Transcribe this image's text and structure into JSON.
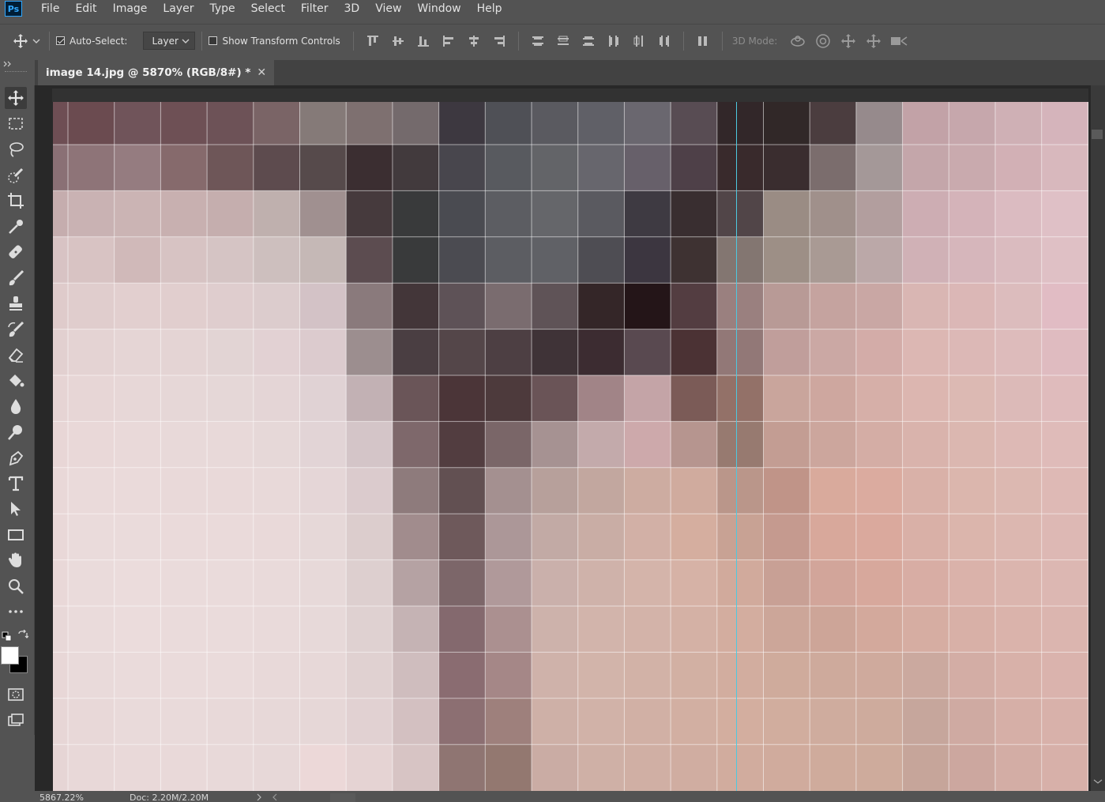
{
  "app": {
    "logo_text": "Ps",
    "brand_color": "#31a8ff"
  },
  "menu": [
    "File",
    "Edit",
    "Image",
    "Layer",
    "Type",
    "Select",
    "Filter",
    "3D",
    "View",
    "Window",
    "Help"
  ],
  "options": {
    "auto_select_label": "Auto-Select:",
    "auto_select_checked": true,
    "layer_dropdown_value": "Layer",
    "show_transform_label": "Show Transform Controls",
    "show_transform_checked": false,
    "mode_3d_label": "3D Mode:"
  },
  "document": {
    "tab_title": "image 14.jpg @ 5870% (RGB/8#) *",
    "close_glyph": "✕"
  },
  "status": {
    "zoom": "5867.22%",
    "doc_size": "Doc: 2.20M/2.20M"
  },
  "tools": [
    "move-tool",
    "rectangular-marquee-tool",
    "lasso-tool",
    "quick-selection-tool",
    "crop-tool",
    "eyedropper-tool",
    "healing-brush-tool",
    "brush-tool",
    "clone-stamp-tool",
    "history-brush-tool",
    "eraser-tool",
    "paint-bucket-tool",
    "blur-tool",
    "dodge-tool",
    "pen-tool",
    "type-tool",
    "path-selection-tool",
    "rectangle-tool",
    "hand-tool",
    "zoom-tool",
    "more-tools"
  ],
  "colors": {
    "foreground": "#ffffff",
    "background": "#000000",
    "guide": "#4dc9e0"
  },
  "pixels": [
    [
      "#6e4e54",
      "#6b4b50",
      "#70545a",
      "#6e5055",
      "#6d5257",
      "#7a6466",
      "#857a78",
      "#7e7070",
      "#746a6c",
      "#3d3840",
      "#4f5056",
      "#5a5a60",
      "#606067",
      "#6a676f",
      "#584c53",
      "#322729",
      "#312828",
      "#4b3d3f",
      "#968a8c",
      "#c2a2a7",
      "#c6a7ac",
      "#cfb0b5",
      "#d5b4bb",
      "#e3c8cc"
    ],
    [
      "#8a7075",
      "#8e7478",
      "#957c80",
      "#866a6c",
      "#6e5658",
      "#5d4b4e",
      "#564a4b",
      "#3b2e31",
      "#423a3d",
      "#48464d",
      "#585a5f",
      "#636468",
      "#67666d",
      "#67606a",
      "#4e4048",
      "#392a2c",
      "#3a2d2f",
      "#7b6d6d",
      "#a49898",
      "#c4a6aa",
      "#c9aaae",
      "#d2b0b5",
      "#d8b8bd",
      "#e3c6ca"
    ],
    [
      "#c5adae",
      "#c9b2b3",
      "#cbb4b4",
      "#c8b0b0",
      "#c5aeae",
      "#bfb0ae",
      "#a09090",
      "#463a3d",
      "#393a3b",
      "#4a4b51",
      "#5c5d62",
      "#65666a",
      "#5a5a60",
      "#3e3a42",
      "#392e30",
      "#514548",
      "#9a8c84",
      "#a0908b",
      "#b29e9e",
      "#cdadb3",
      "#d4b3b9",
      "#dbbbc1",
      "#dfc0c6",
      "#e5c8cd"
    ],
    [
      "#d8c3c4",
      "#d8c3c3",
      "#d0b9b9",
      "#d7c3c3",
      "#d5c4c4",
      "#cdbfbe",
      "#c5b8b6",
      "#5c4c50",
      "#393a3b",
      "#4b4b51",
      "#5c5d62",
      "#606166",
      "#4e4d53",
      "#3c3640",
      "#3e3232",
      "#837671",
      "#9d8f86",
      "#a99a94",
      "#bba8a8",
      "#d0b1b6",
      "#d6b6bb",
      "#dabbbf",
      "#dfc0c5",
      "#e3c5ca"
    ],
    [
      "#dfcbcb",
      "#e0cdcd",
      "#e2cfcf",
      "#e1cece",
      "#dfcdce",
      "#dccccd",
      "#d3c2c6",
      "#8a7a7c",
      "#433639",
      "#5e5257",
      "#7a6c6f",
      "#5f5357",
      "#342628",
      "#241518",
      "#533d41",
      "#9a807f",
      "#b89a96",
      "#c5a39f",
      "#c9a7a4",
      "#d9b6b3",
      "#dbb7b6",
      "#dcbcbd",
      "#e1bcc4",
      "#e3c5c8"
    ],
    [
      "#e2d0d0",
      "#e4d3d3",
      "#e5d5d5",
      "#e4d4d4",
      "#e2d4d4",
      "#e2d1d3",
      "#dccbce",
      "#9c8e8f",
      "#4a3e42",
      "#544649",
      "#4d3f43",
      "#3f3337",
      "#3c2c31",
      "#594950",
      "#4b3234",
      "#927877",
      "#c09e9b",
      "#cba8a4",
      "#d3aca8",
      "#dcb7b3",
      "#dcb8b6",
      "#ddbbbb",
      "#dfbbc0",
      "#e3c3c7"
    ],
    [
      "#e6d4d4",
      "#e7d6d6",
      "#e7d7d7",
      "#e6d7d7",
      "#e5d7d7",
      "#e4d5d6",
      "#e0d2d4",
      "#c2b1b4",
      "#6a5558",
      "#4b3538",
      "#4d3a3c",
      "#6a5457",
      "#a18487",
      "#c4a4a7",
      "#7b5b57",
      "#937168",
      "#c9a59c",
      "#cea79f",
      "#d6afa8",
      "#dcb6b0",
      "#dcb9b3",
      "#dcbab8",
      "#dfbbbc",
      "#e3c2c4"
    ],
    [
      "#e8d6d6",
      "#e9d8d8",
      "#e9d9d9",
      "#e8d9d9",
      "#e8d9d9",
      "#e6d8d8",
      "#e2d4d6",
      "#d4c5c8",
      "#7e686b",
      "#523d40",
      "#7a6668",
      "#a69292",
      "#c3aaab",
      "#cda9ab",
      "#b6958f",
      "#977a70",
      "#c39d93",
      "#cca69d",
      "#d4ada5",
      "#d9b3ac",
      "#dbb7b0",
      "#ddb9b5",
      "#dfbbb9",
      "#e1bfbf"
    ],
    [
      "#e9d8d8",
      "#eadada",
      "#eadada",
      "#e9d9d9",
      "#e9d9d9",
      "#e8d9d9",
      "#e5d6d7",
      "#dbcbcd",
      "#8e7b7c",
      "#625052",
      "#a49090",
      "#b7a09b",
      "#c2a79f",
      "#cdaca1",
      "#d0ab9e",
      "#ba968a",
      "#c09488",
      "#d9aa9c",
      "#dbab9f",
      "#d9b1a8",
      "#dbb6ad",
      "#dcb8b1",
      "#deb9b5",
      "#e0bcbb"
    ],
    [
      "#e9d8d8",
      "#eadbdb",
      "#eadbdb",
      "#eadada",
      "#eadada",
      "#e9d9d9",
      "#e6d8d8",
      "#dccdcd",
      "#a18c8d",
      "#6e595b",
      "#ac9798",
      "#c2aaa5",
      "#c9ada5",
      "#d2b0a6",
      "#d5ae9f",
      "#c8a294",
      "#c59a8f",
      "#d8a89b",
      "#daa99d",
      "#d9b0a7",
      "#dbb5ac",
      "#dcb7b0",
      "#ddb8b4",
      "#dfbbba"
    ],
    [
      "#e9d8d8",
      "#eadbdb",
      "#ebdcdc",
      "#eadbdb",
      "#eadbdb",
      "#e9dada",
      "#e7d9d9",
      "#ddcfcf",
      "#b5a2a3",
      "#7c6669",
      "#b0999a",
      "#cab0ab",
      "#cfb2aa",
      "#d4b4aa",
      "#d6b2a6",
      "#d1aa9c",
      "#c8a095",
      "#d2a59a",
      "#d7a89c",
      "#d8ada4",
      "#dab2aa",
      "#dbb5ae",
      "#dcb7b2",
      "#ddb9b7"
    ],
    [
      "#e8d8d8",
      "#eadbdb",
      "#ebdcdc",
      "#eadbdb",
      "#eadbdb",
      "#e9dada",
      "#e7d9d9",
      "#dfd1d1",
      "#c5b3b4",
      "#84696e",
      "#ab9090",
      "#cdb2ab",
      "#d2b4ab",
      "#d3b3a9",
      "#d4b1a5",
      "#d3ad9f",
      "#cca699",
      "#cda598",
      "#d3a99c",
      "#d6ada2",
      "#d8b0a7",
      "#dab3ab",
      "#dbb5af",
      "#dcb7b3"
    ],
    [
      "#e8d7d7",
      "#e9dada",
      "#eadbdb",
      "#eadbdb",
      "#eadbdb",
      "#e8d9d9",
      "#e7d8d8",
      "#e0d1d1",
      "#cfbdbe",
      "#8a6c71",
      "#a58787",
      "#cfb2aa",
      "#d2b4aa",
      "#d2b2a7",
      "#d2b0a3",
      "#d2ad9f",
      "#cfab9c",
      "#ceaa9c",
      "#cfaa9d",
      "#cba99f",
      "#d3ada5",
      "#d8b1a9",
      "#dab3ad",
      "#dbb5b0"
    ],
    [
      "#e7d6d6",
      "#e8d8d8",
      "#e9dada",
      "#e9dada",
      "#e8d9d9",
      "#e7d8d8",
      "#e6d7d7",
      "#e1d1d2",
      "#d3c0c1",
      "#8c6f72",
      "#9e807c",
      "#ceb0a7",
      "#d1b2a8",
      "#d1b0a5",
      "#d2afa2",
      "#d3ae9f",
      "#d1ad9e",
      "#cfac9e",
      "#ceab9d",
      "#c6a69c",
      "#cfaaa2",
      "#d6afa7",
      "#d8b1aa",
      "#dab4ae"
    ],
    [
      "#e6d5d5",
      "#e8d8d8",
      "#e9d9d9",
      "#e9d9d9",
      "#e8d9d9",
      "#e7d8d8",
      "#ecd8d8",
      "#e5d3d3",
      "#d7c4c4",
      "#8f7572",
      "#937870",
      "#caaca4",
      "#cfb0a6",
      "#d0afa4",
      "#d0ada1",
      "#d1ac9e",
      "#d0ab9d",
      "#cfab9c",
      "#ceab9c",
      "#c6a59a",
      "#cca79f",
      "#d3ada5",
      "#d7b0a9",
      "#d9b3ad"
    ]
  ]
}
